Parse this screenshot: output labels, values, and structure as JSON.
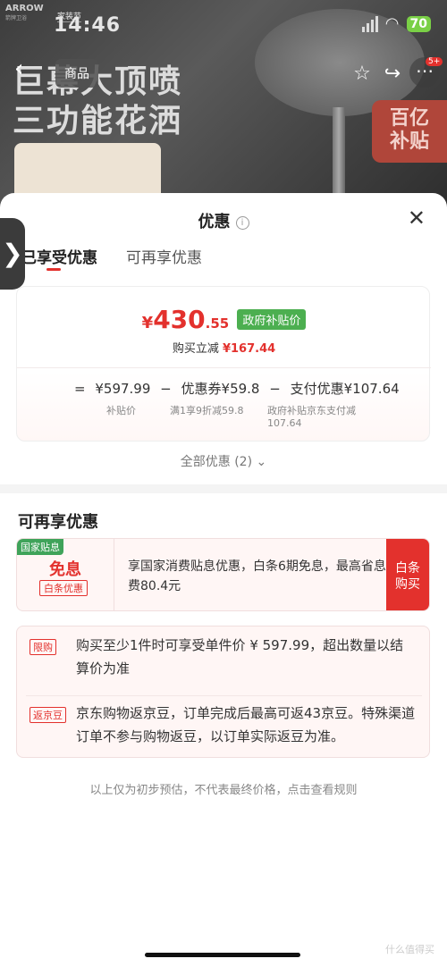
{
  "status_bar": {
    "time": "14:46",
    "battery": "70"
  },
  "background": {
    "brand": "ARROW",
    "brand_sub": "箭牌卫浴",
    "festival": "家装节",
    "headline_line1": "巨幕大顶喷",
    "headline_line2": "三功能花洒",
    "nav_back_icon": "‹",
    "nav_tab_label": "商品",
    "more_badge": "5+",
    "subsidy_badge_line1": "百亿",
    "subsidy_badge_line2": "补贴"
  },
  "sheet": {
    "title": "优惠",
    "info_icon": "i",
    "close_icon": "✕",
    "tabs": [
      {
        "label": "已享受优惠",
        "active": true
      },
      {
        "label": "可再享优惠",
        "active": false
      }
    ]
  },
  "price_card": {
    "currency": "¥",
    "price_int": "430",
    "price_dec": ".55",
    "price_tag": "政府补贴价",
    "discount_label": "购买立减",
    "discount_value": "¥167.44",
    "formula": {
      "eq": "=",
      "subsidy_price": "¥597.99",
      "minus1": "−",
      "coupon": "优惠券¥59.8",
      "minus2": "−",
      "payment": "支付优惠¥107.64"
    },
    "formula_sub": {
      "subsidy_price_label": "补贴价",
      "coupon_label": "满1享9折减59.8",
      "payment_label_line1": "政府补贴京东支付减",
      "payment_label_line2": "107.64"
    }
  },
  "all_offers": "全部优惠 (2)",
  "all_offers_chevron": "⌄",
  "section2": {
    "title": "可再享优惠",
    "offer": {
      "gov_badge": "国家贴息",
      "free_label": "免息",
      "baitiao_tag": "白条优惠",
      "text": "享国家消费贴息优惠，白条6期免息，最高省息费80.4元",
      "buy_btn_line1": "白条",
      "buy_btn_line2": "购买"
    },
    "notes": [
      {
        "tag": "限购",
        "text": "购买至少1件时可享受单件价 ¥ 597.99，超出数量以结算价为准"
      },
      {
        "tag": "返京豆",
        "text": "京东购物返京豆，订单完成后最高可返43京豆。特殊渠道订单不参与购物返豆，以订单实际返豆为准。"
      }
    ]
  },
  "footer_note": "以上仅为初步预估，不代表最终价格，点击查看规则",
  "watermark": "什么值得买",
  "side_handle_icon": "❯",
  "colors": {
    "accent_red": "#e3312d",
    "green_tag": "#4caf50"
  }
}
